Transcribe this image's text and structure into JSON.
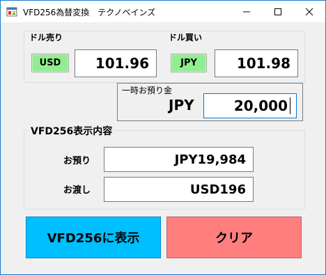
{
  "window": {
    "title": "VFD256為替変換　テクノベインズ"
  },
  "sell": {
    "label": "ドル売り",
    "currency": "USD",
    "rate": "101.96"
  },
  "buy": {
    "label": "ドル買い",
    "currency": "JPY",
    "rate": "101.98"
  },
  "deposit": {
    "caption": "一時お預り金",
    "currency": "JPY",
    "amount": "20,000"
  },
  "display": {
    "group_label": "VFD256表示内容",
    "received_label": "お預り",
    "received_value": "JPY19,984",
    "change_label": "お渡し",
    "change_value": "USD196"
  },
  "buttons": {
    "show": "VFD256に表示",
    "clear": "クリア"
  },
  "colors": {
    "currency_badge": "#90ee90",
    "show_button": "#00bfff",
    "clear_button": "#ff7f7f",
    "focus_border": "#0078d7"
  },
  "icons": {
    "app": "app-window-icon",
    "minimize": "minimize-icon",
    "maximize": "maximize-icon",
    "close": "close-icon"
  }
}
